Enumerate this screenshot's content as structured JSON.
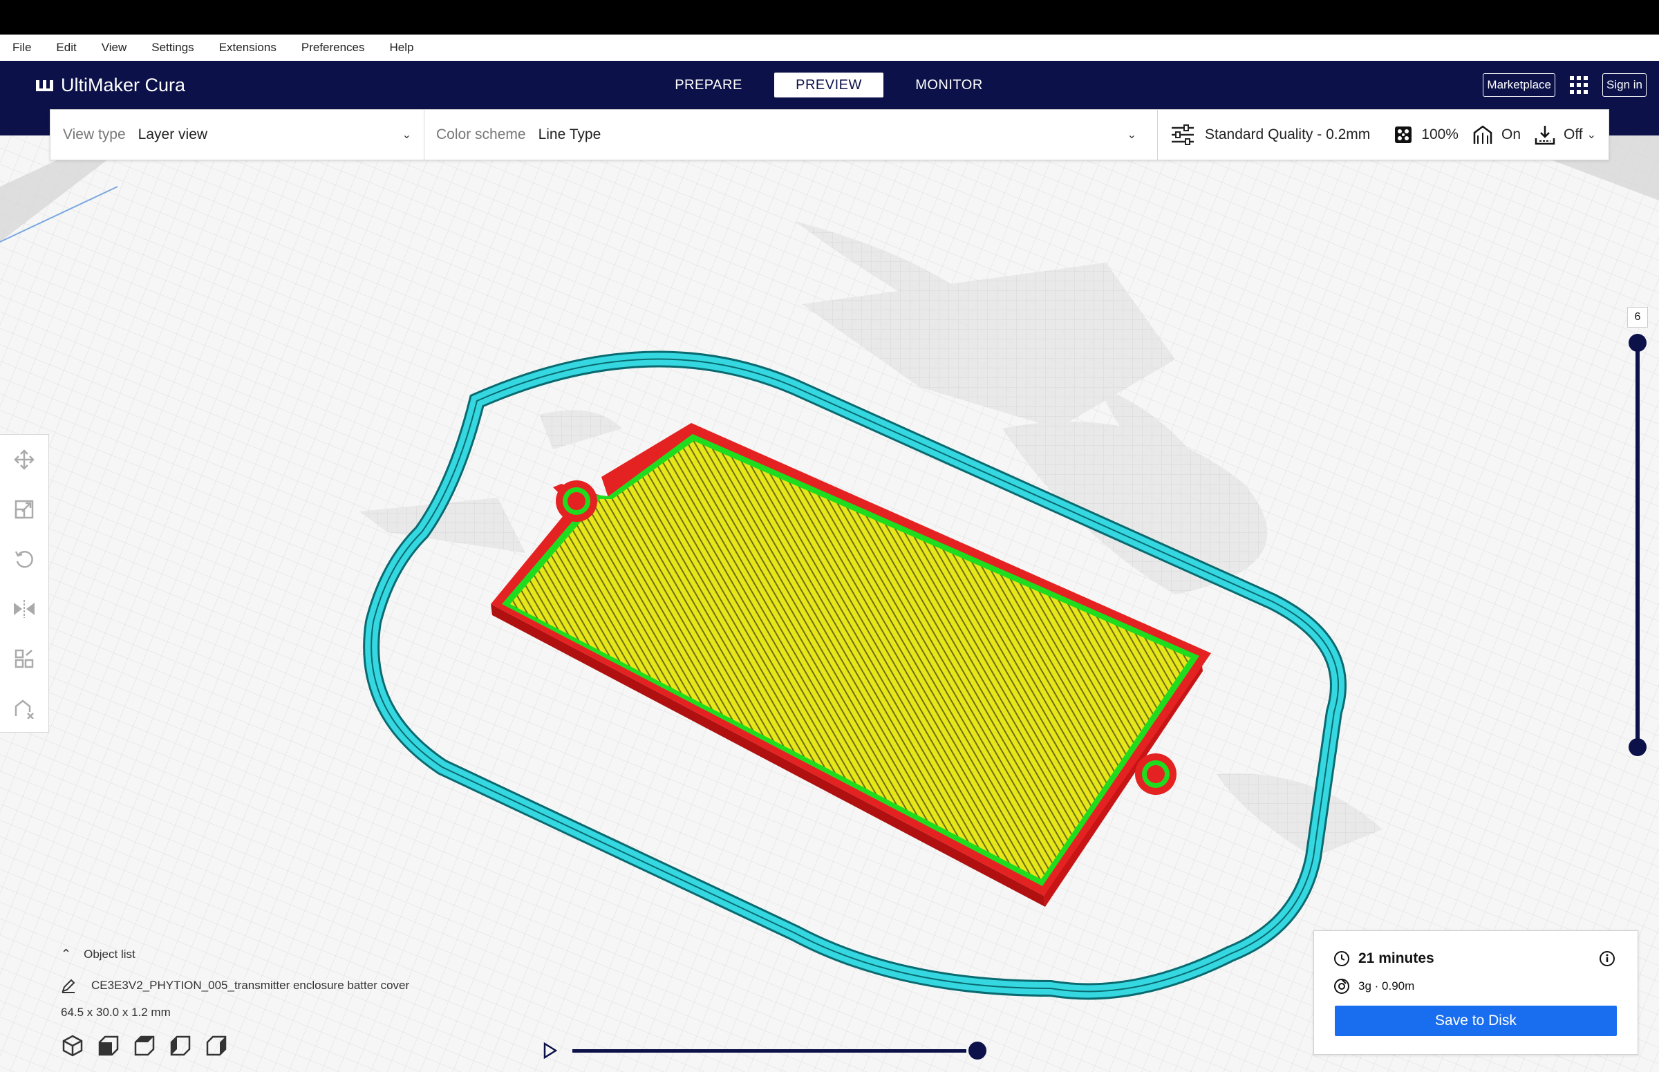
{
  "menu": [
    "File",
    "Edit",
    "View",
    "Settings",
    "Extensions",
    "Preferences",
    "Help"
  ],
  "header": {
    "app_name": "UltiMaker Cura",
    "stages": [
      "PREPARE",
      "PREVIEW",
      "MONITOR"
    ],
    "active_stage": "PREVIEW",
    "marketplace_label": "Marketplace",
    "sign_in_label": "Sign in",
    "apps_icon": "grid-apps-icon"
  },
  "toolbar": {
    "view_type_label": "View type",
    "view_type_value": "Layer view",
    "color_scheme_label": "Color scheme",
    "color_scheme_value": "Line Type",
    "quality": "Standard Quality - 0.2mm",
    "infill": "100%",
    "support": "On",
    "adhesion": "Off"
  },
  "left_tools": [
    "move-icon",
    "scale-icon",
    "rotate-icon",
    "mirror-icon",
    "per-model-settings-icon",
    "support-blocker-icon"
  ],
  "layer_slider": {
    "top_value": "6"
  },
  "object_list": {
    "header": "Object list",
    "object_name": "CE3E3V2_PHYTION_005_transmitter enclosure batter cover",
    "dimensions": "64.5 x 30.0 x 1.2 mm"
  },
  "view_orientation_icons": [
    "3d-view-icon",
    "front-view-icon",
    "top-view-icon",
    "left-view-icon",
    "right-view-icon"
  ],
  "estimate": {
    "time": "21 minutes",
    "material": "3g · 0.90m",
    "save_label": "Save to Disk"
  },
  "colors": {
    "header_bg": "#0c1249",
    "accent_blue": "#196ef0",
    "skirt": "#33d9e0",
    "wall_outer": "#e82020",
    "wall_inner": "#22e022",
    "skin": "#e8e81a"
  }
}
